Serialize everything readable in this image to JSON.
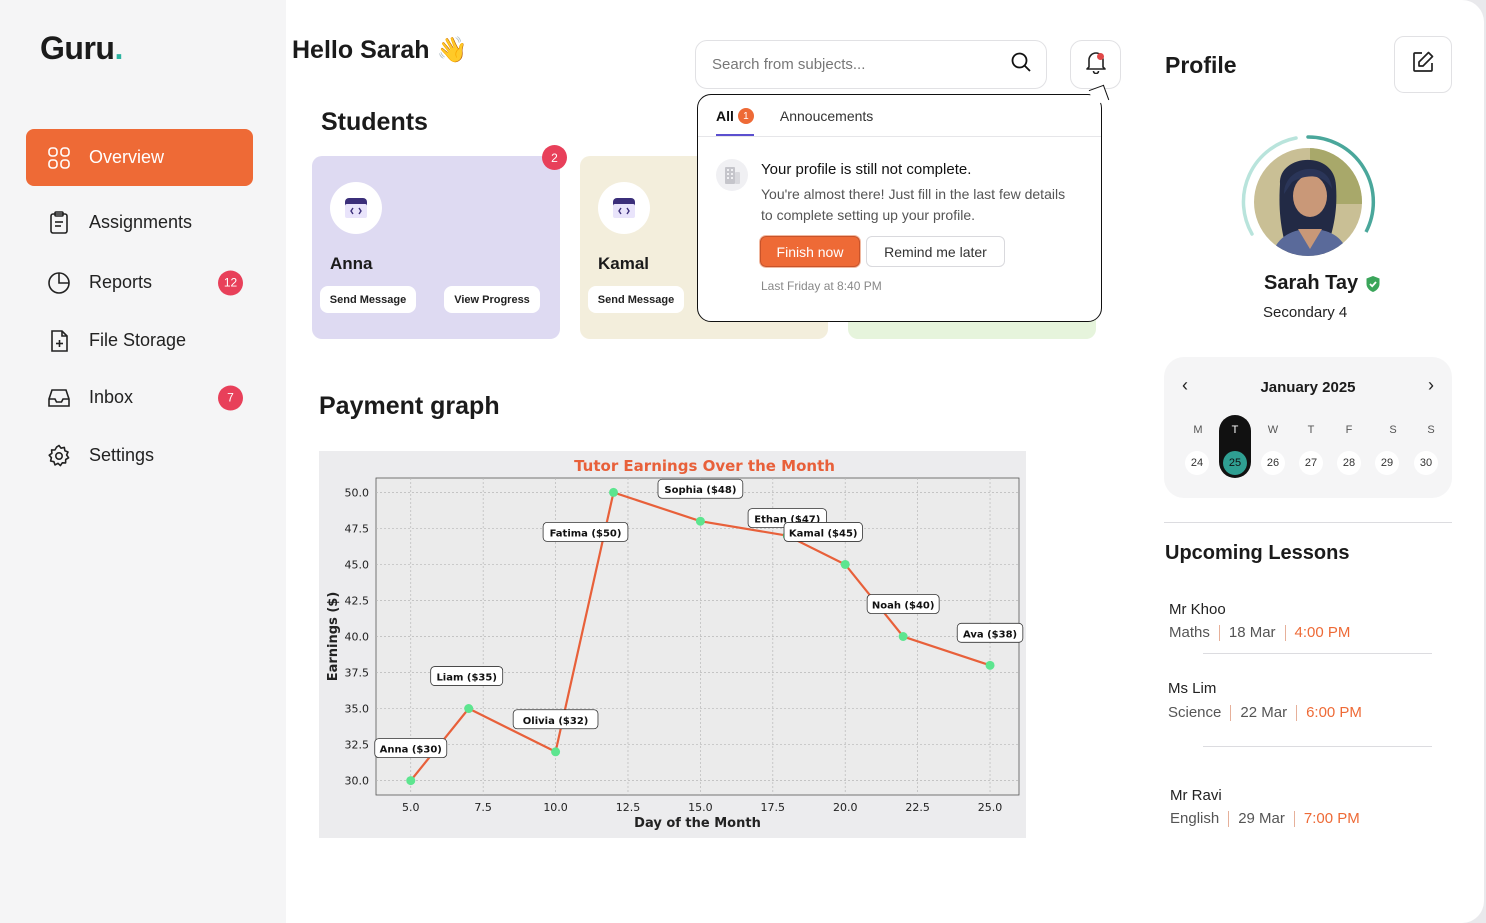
{
  "app": {
    "logo": "Guru",
    "logo_dot": "."
  },
  "sidebar": {
    "items": [
      {
        "label": "Overview",
        "icon": "grid-icon",
        "active": true,
        "badge": ""
      },
      {
        "label": "Assignments",
        "icon": "clipboard-icon",
        "badge": ""
      },
      {
        "label": "Reports",
        "icon": "pie-chart-icon",
        "badge": "12"
      },
      {
        "label": "File Storage",
        "icon": "file-plus-icon",
        "badge": ""
      },
      {
        "label": "Inbox",
        "icon": "inbox-icon",
        "badge": "7"
      },
      {
        "label": "Settings",
        "icon": "gear-icon",
        "badge": ""
      }
    ]
  },
  "header": {
    "greeting": "Hello Sarah",
    "greeting_emoji": "👋",
    "search_placeholder": "Search from subjects..."
  },
  "students": {
    "title": "Students",
    "cards": [
      {
        "name": "Anna",
        "send": "Send Message",
        "view": "View Progress",
        "badge": "2",
        "color": "#dedaf2"
      },
      {
        "name": "Kamal",
        "send": "Send Message",
        "color": "#f3eedc"
      },
      {
        "color": "#e6f4dc"
      }
    ]
  },
  "notifications": {
    "tabs": [
      {
        "label": "All",
        "badge": "1"
      },
      {
        "label": "Annoucements"
      }
    ],
    "item": {
      "title": "Your profile is still not complete.",
      "body": "You're almost there! Just fill in the last few details to complete setting up your profile.",
      "primary": "Finish now",
      "secondary": "Remind me later",
      "time": "Last Friday at 8:40 PM"
    }
  },
  "payment": {
    "title": "Payment graph"
  },
  "chart_data": {
    "type": "line",
    "title": "Tutor Earnings Over the Month",
    "xlabel": "Day of the Month",
    "ylabel": "Earnings ($)",
    "xlim": [
      3.8,
      26.0
    ],
    "ylim": [
      29.0,
      51.0
    ],
    "xticks": [
      "5.0",
      "7.5",
      "10.0",
      "12.5",
      "15.0",
      "17.5",
      "20.0",
      "22.5",
      "25.0"
    ],
    "xtick_values": [
      5,
      7.5,
      10,
      12.5,
      15,
      17.5,
      20,
      22.5,
      25
    ],
    "yticks": [
      "30.0",
      "32.5",
      "35.0",
      "37.5",
      "40.0",
      "42.5",
      "45.0",
      "47.5",
      "50.0"
    ],
    "ytick_values": [
      30,
      32.5,
      35,
      37.5,
      40,
      42.5,
      45,
      47.5,
      50
    ],
    "grid": true,
    "line_color": "#e8603a",
    "marker_color": "#5de58f",
    "points": [
      {
        "x": 5,
        "y": 30,
        "label": "Anna ($30)"
      },
      {
        "x": 7,
        "y": 35,
        "label": "Liam ($35)"
      },
      {
        "x": 10,
        "y": 32,
        "label": "Olivia ($32)"
      },
      {
        "x": 12,
        "y": 50,
        "label": "Fatima ($50)"
      },
      {
        "x": 15,
        "y": 48,
        "label": "Sophia ($48)"
      },
      {
        "x": 18,
        "y": 47,
        "label": "Ethan ($47)"
      },
      {
        "x": 20,
        "y": 45,
        "label": "Kamal ($45)"
      },
      {
        "x": 22,
        "y": 40,
        "label": "Noah ($40)"
      },
      {
        "x": 25,
        "y": 38,
        "label": "Ava ($38)"
      }
    ]
  },
  "profile": {
    "title": "Profile",
    "name": "Sarah Tay",
    "grade": "Secondary 4"
  },
  "calendar": {
    "month": "January 2025",
    "days_of_week": [
      "M",
      "T",
      "W",
      "T",
      "F",
      "S",
      "S"
    ],
    "dates": [
      "24",
      "25",
      "26",
      "27",
      "28",
      "29",
      "30"
    ],
    "selected_index": 1
  },
  "lessons": {
    "title": "Upcoming Lessons",
    "items": [
      {
        "teacher": "Mr Khoo",
        "subject": "Maths",
        "date": "18 Mar",
        "time": "4:00 PM"
      },
      {
        "teacher": "Ms Lim",
        "subject": "Science",
        "date": "22 Mar",
        "time": "6:00 PM"
      },
      {
        "teacher": "Mr Ravi",
        "subject": "English",
        "date": "29 Mar",
        "time": "7:00 PM"
      }
    ]
  }
}
